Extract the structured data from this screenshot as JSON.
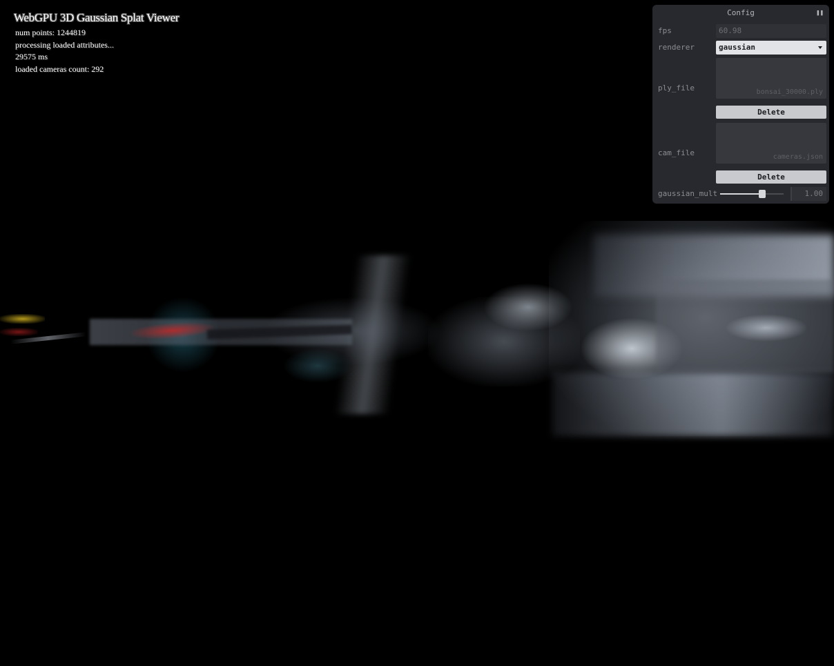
{
  "info": {
    "title": "WebGPU 3D Gaussian Splat Viewer",
    "num_points": "num points: 1244819",
    "status": "processing loaded attributes...",
    "elapsed": "29575 ms",
    "cameras": "loaded cameras count: 292"
  },
  "config": {
    "title": "Config",
    "toggle_icon": "pause-icon",
    "fps_label": "fps",
    "fps_value": "60.98",
    "renderer_label": "renderer",
    "renderer_value": "gaussian",
    "ply_label": "ply_file",
    "ply_filename": "bonsai_30000.ply",
    "ply_delete": "Delete",
    "cam_label": "cam_file",
    "cam_filename": "cameras.json",
    "cam_delete": "Delete",
    "gaussian_mult_label": "gaussian_mult",
    "gaussian_mult_value": "1.00",
    "gaussian_mult_fraction": 0.66
  },
  "colors": {
    "background": "#000000",
    "panel_bg": "#28292e",
    "field_bg": "#37383d",
    "accent_light": "#e2e3e6"
  }
}
